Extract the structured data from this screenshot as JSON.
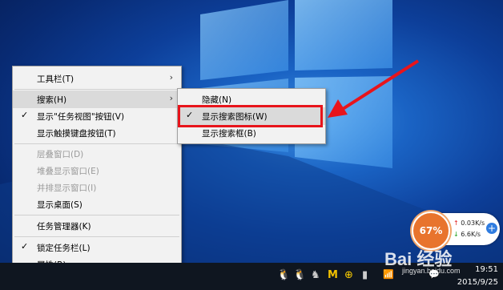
{
  "context_menu": {
    "items": [
      {
        "label": "工具栏(T)",
        "check": "",
        "arrow": "›",
        "state": "normal"
      },
      {
        "label": "搜索(H)",
        "check": "",
        "arrow": "›",
        "state": "highlighted"
      },
      {
        "label": "显示\"任务视图\"按钮(V)",
        "check": "✓",
        "arrow": "",
        "state": "normal"
      },
      {
        "label": "显示触摸键盘按钮(T)",
        "check": "",
        "arrow": "",
        "state": "normal"
      },
      {
        "label": "层叠窗口(D)",
        "check": "",
        "arrow": "",
        "state": "disabled"
      },
      {
        "label": "堆叠显示窗口(E)",
        "check": "",
        "arrow": "",
        "state": "disabled"
      },
      {
        "label": "并排显示窗口(I)",
        "check": "",
        "arrow": "",
        "state": "disabled"
      },
      {
        "label": "显示桌面(S)",
        "check": "",
        "arrow": "",
        "state": "normal"
      },
      {
        "label": "任务管理器(K)",
        "check": "",
        "arrow": "",
        "state": "normal"
      },
      {
        "label": "锁定任务栏(L)",
        "check": "✓",
        "arrow": "",
        "state": "normal"
      },
      {
        "label": "属性(R)",
        "check": "",
        "arrow": "",
        "state": "normal"
      }
    ]
  },
  "search_submenu": {
    "items": [
      {
        "label": "隐藏(N)",
        "check": ""
      },
      {
        "label": "显示搜索图标(W)",
        "check": "✓"
      },
      {
        "label": "显示搜索框(B)",
        "check": ""
      }
    ]
  },
  "speed_widget": {
    "percent": "67%",
    "up": "0.03K/s",
    "down": "6.6K/s",
    "up_arrow": "↑",
    "down_arrow": "↓",
    "plus": "+"
  },
  "clock": {
    "time": "19:51",
    "date": "2015/9/25"
  },
  "watermark": {
    "text": "Bai 经验",
    "url": "jingyan.baidu.com"
  },
  "colors": {
    "annotation_red": "#e8141b",
    "taskbar": "#0f1620",
    "desktop_blue": "#1a63c4"
  },
  "tray_icons": [
    "qq-penguin-icon",
    "qq-penguin-icon",
    "app-icon",
    "m-icon",
    "plus-icon",
    "battery-icon",
    "network-icon",
    "volume-icon",
    "ime-icon",
    "notification-icon"
  ]
}
